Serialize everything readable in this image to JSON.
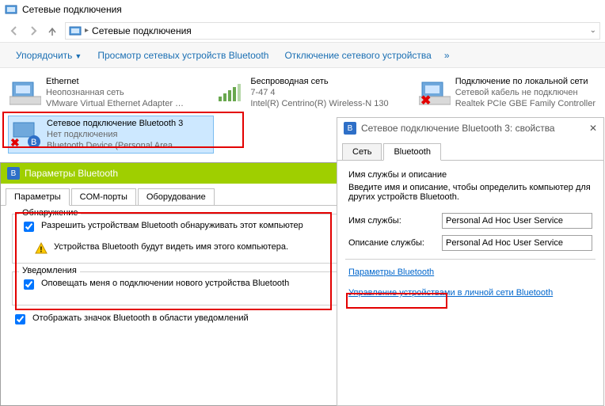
{
  "window": {
    "title": "Сетевые подключения"
  },
  "breadcrumb": {
    "text": "Сетевые подключения"
  },
  "toolbar": {
    "organize": "Упорядочить",
    "view_bt": "Просмотр сетевых устройств Bluetooth",
    "disable": "Отключение сетевого устройства",
    "more": "»"
  },
  "connections": [
    {
      "name": "Ethernet",
      "status": "Неопознанная сеть",
      "device": "VMware Virtual Ethernet Adapter …"
    },
    {
      "name": "Беспроводная сеть",
      "status": "7-47  4",
      "device": "Intel(R) Centrino(R) Wireless-N 130"
    },
    {
      "name": "Подключение по локальной сети",
      "status": "Сетевой кабель не подключен",
      "device": "Realtek PCIe GBE Family Controller"
    },
    {
      "name": "Сетевое подключение Bluetooth 3",
      "status": "Нет подключения",
      "device": "Bluetooth Device (Personal Area …"
    }
  ],
  "bt_settings": {
    "title": "Параметры Bluetooth",
    "tabs": {
      "params": "Параметры",
      "com": "COM-порты",
      "hw": "Оборудование"
    },
    "discovery": {
      "legend": "Обнаружение",
      "allow": "Разрешить устройствам Bluetooth обнаруживать этот компьютер",
      "warn": "Устройства Bluetooth будут видеть имя этого компьютера."
    },
    "notify": {
      "legend": "Уведомления",
      "on_connect": "Оповещать меня о подключении нового устройства Bluetooth"
    },
    "tray": "Отображать значок Bluetooth в области уведомлений"
  },
  "prop": {
    "title": "Сетевое подключение Bluetooth 3: свойства",
    "tabs": {
      "net": "Сеть",
      "bt": "Bluetooth"
    },
    "service_heading": "Имя службы и описание",
    "service_hint": "Введите имя и описание, чтобы определить компьютер для других устройств Bluetooth.",
    "service_name_lbl": "Имя службы:",
    "service_name_val": "Personal Ad Hoc User Service",
    "service_desc_lbl": "Описание службы:",
    "service_desc_val": "Personal Ad Hoc User Service",
    "link_params": "Параметры Bluetooth",
    "link_manage": "Управление устройствами в личной сети Bluetooth"
  }
}
